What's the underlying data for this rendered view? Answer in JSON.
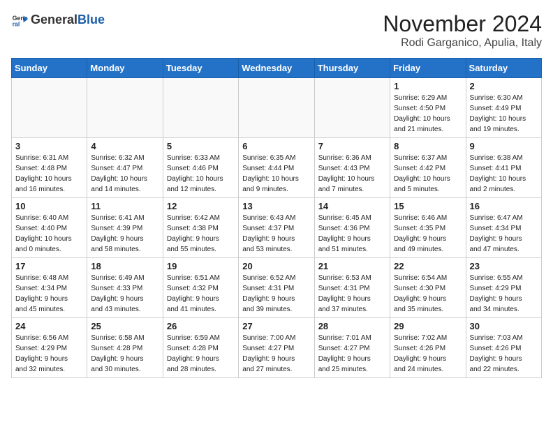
{
  "header": {
    "logo_general": "General",
    "logo_blue": "Blue",
    "month": "November 2024",
    "location": "Rodi Garganico, Apulia, Italy"
  },
  "weekdays": [
    "Sunday",
    "Monday",
    "Tuesday",
    "Wednesday",
    "Thursday",
    "Friday",
    "Saturday"
  ],
  "weeks": [
    [
      {
        "day": "",
        "info": ""
      },
      {
        "day": "",
        "info": ""
      },
      {
        "day": "",
        "info": ""
      },
      {
        "day": "",
        "info": ""
      },
      {
        "day": "",
        "info": ""
      },
      {
        "day": "1",
        "info": "Sunrise: 6:29 AM\nSunset: 4:50 PM\nDaylight: 10 hours\nand 21 minutes."
      },
      {
        "day": "2",
        "info": "Sunrise: 6:30 AM\nSunset: 4:49 PM\nDaylight: 10 hours\nand 19 minutes."
      }
    ],
    [
      {
        "day": "3",
        "info": "Sunrise: 6:31 AM\nSunset: 4:48 PM\nDaylight: 10 hours\nand 16 minutes."
      },
      {
        "day": "4",
        "info": "Sunrise: 6:32 AM\nSunset: 4:47 PM\nDaylight: 10 hours\nand 14 minutes."
      },
      {
        "day": "5",
        "info": "Sunrise: 6:33 AM\nSunset: 4:46 PM\nDaylight: 10 hours\nand 12 minutes."
      },
      {
        "day": "6",
        "info": "Sunrise: 6:35 AM\nSunset: 4:44 PM\nDaylight: 10 hours\nand 9 minutes."
      },
      {
        "day": "7",
        "info": "Sunrise: 6:36 AM\nSunset: 4:43 PM\nDaylight: 10 hours\nand 7 minutes."
      },
      {
        "day": "8",
        "info": "Sunrise: 6:37 AM\nSunset: 4:42 PM\nDaylight: 10 hours\nand 5 minutes."
      },
      {
        "day": "9",
        "info": "Sunrise: 6:38 AM\nSunset: 4:41 PM\nDaylight: 10 hours\nand 2 minutes."
      }
    ],
    [
      {
        "day": "10",
        "info": "Sunrise: 6:40 AM\nSunset: 4:40 PM\nDaylight: 10 hours\nand 0 minutes."
      },
      {
        "day": "11",
        "info": "Sunrise: 6:41 AM\nSunset: 4:39 PM\nDaylight: 9 hours\nand 58 minutes."
      },
      {
        "day": "12",
        "info": "Sunrise: 6:42 AM\nSunset: 4:38 PM\nDaylight: 9 hours\nand 55 minutes."
      },
      {
        "day": "13",
        "info": "Sunrise: 6:43 AM\nSunset: 4:37 PM\nDaylight: 9 hours\nand 53 minutes."
      },
      {
        "day": "14",
        "info": "Sunrise: 6:45 AM\nSunset: 4:36 PM\nDaylight: 9 hours\nand 51 minutes."
      },
      {
        "day": "15",
        "info": "Sunrise: 6:46 AM\nSunset: 4:35 PM\nDaylight: 9 hours\nand 49 minutes."
      },
      {
        "day": "16",
        "info": "Sunrise: 6:47 AM\nSunset: 4:34 PM\nDaylight: 9 hours\nand 47 minutes."
      }
    ],
    [
      {
        "day": "17",
        "info": "Sunrise: 6:48 AM\nSunset: 4:34 PM\nDaylight: 9 hours\nand 45 minutes."
      },
      {
        "day": "18",
        "info": "Sunrise: 6:49 AM\nSunset: 4:33 PM\nDaylight: 9 hours\nand 43 minutes."
      },
      {
        "day": "19",
        "info": "Sunrise: 6:51 AM\nSunset: 4:32 PM\nDaylight: 9 hours\nand 41 minutes."
      },
      {
        "day": "20",
        "info": "Sunrise: 6:52 AM\nSunset: 4:31 PM\nDaylight: 9 hours\nand 39 minutes."
      },
      {
        "day": "21",
        "info": "Sunrise: 6:53 AM\nSunset: 4:31 PM\nDaylight: 9 hours\nand 37 minutes."
      },
      {
        "day": "22",
        "info": "Sunrise: 6:54 AM\nSunset: 4:30 PM\nDaylight: 9 hours\nand 35 minutes."
      },
      {
        "day": "23",
        "info": "Sunrise: 6:55 AM\nSunset: 4:29 PM\nDaylight: 9 hours\nand 34 minutes."
      }
    ],
    [
      {
        "day": "24",
        "info": "Sunrise: 6:56 AM\nSunset: 4:29 PM\nDaylight: 9 hours\nand 32 minutes."
      },
      {
        "day": "25",
        "info": "Sunrise: 6:58 AM\nSunset: 4:28 PM\nDaylight: 9 hours\nand 30 minutes."
      },
      {
        "day": "26",
        "info": "Sunrise: 6:59 AM\nSunset: 4:28 PM\nDaylight: 9 hours\nand 28 minutes."
      },
      {
        "day": "27",
        "info": "Sunrise: 7:00 AM\nSunset: 4:27 PM\nDaylight: 9 hours\nand 27 minutes."
      },
      {
        "day": "28",
        "info": "Sunrise: 7:01 AM\nSunset: 4:27 PM\nDaylight: 9 hours\nand 25 minutes."
      },
      {
        "day": "29",
        "info": "Sunrise: 7:02 AM\nSunset: 4:26 PM\nDaylight: 9 hours\nand 24 minutes."
      },
      {
        "day": "30",
        "info": "Sunrise: 7:03 AM\nSunset: 4:26 PM\nDaylight: 9 hours\nand 22 minutes."
      }
    ]
  ]
}
